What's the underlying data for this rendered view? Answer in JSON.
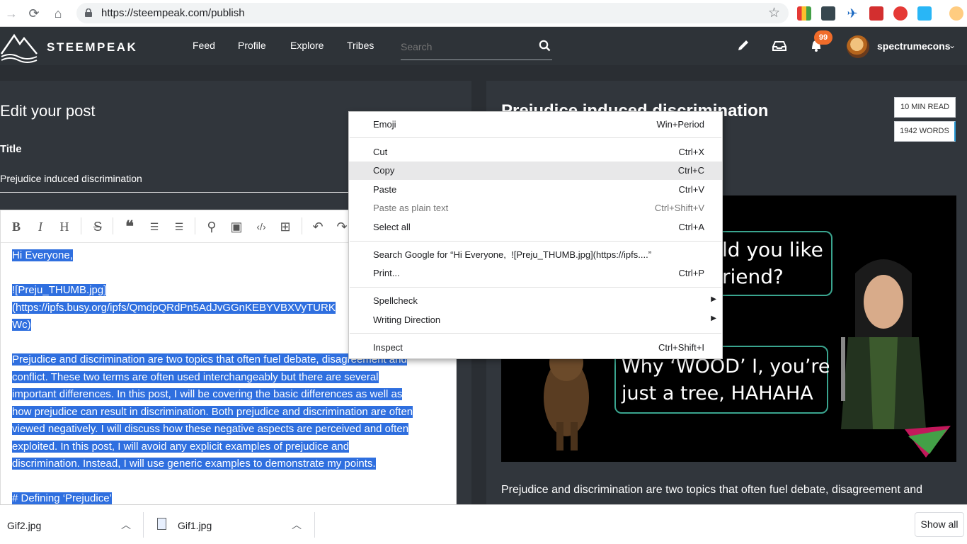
{
  "browser": {
    "url": "https://steempeak.com/publish"
  },
  "header": {
    "logo_text": "STEEMPEAK",
    "nav": [
      "Feed",
      "Profile",
      "Explore",
      "Tribes"
    ],
    "search_placeholder": "Search",
    "notification_count": "99",
    "username": "spectrumecons"
  },
  "editor": {
    "heading": "Edit your post",
    "title_label": "Title",
    "title_value": "Prejudice induced discrimination",
    "lines": {
      "l1": "Hi Everyone,",
      "l2": "![Preju_THUMB.jpg]",
      "l3": "(https://ipfs.busy.org/ipfs/QmdpQRdPn5AdJvGGnKEBYVBXVyTURK",
      "l4": "Wc)",
      "p1": "Prejudice and discrimination are two topics that often fuel debate, disagreement and",
      "p2": "conflict. These two terms are often used interchangeably but there are several",
      "p3": "important differences. In this post, I will be covering the basic differences as well as",
      "p4": "how prejudice can result in discrimination. Both prejudice and discrimination are often",
      "p5": "viewed negatively. I will discuss how these negative aspects are perceived and often",
      "p6": "exploited. In this post, I will avoid any explicit examples of prejudice and",
      "p7": "discrimination. Instead, I will use generic examples to demonstrate my points.",
      "h1": "# Defining ‘Prejudice’"
    }
  },
  "preview": {
    "title": "Prejudice induced discrimination",
    "read_time": "10 MIN READ",
    "word_count": "1942 WORDS",
    "image_text_1a": "ld you like",
    "image_text_1b": "riend?",
    "image_text_2a": "Why ‘WOOD’ I, you’re",
    "image_text_2b": "just a tree, HAHAHA",
    "body_line1": "Prejudice and discrimination are two topics that often fuel debate, disagreement and"
  },
  "context_menu": {
    "emoji": {
      "label": "Emoji",
      "shortcut": "Win+Period"
    },
    "cut": {
      "label": "Cut",
      "shortcut": "Ctrl+X"
    },
    "copy": {
      "label": "Copy",
      "shortcut": "Ctrl+C"
    },
    "paste": {
      "label": "Paste",
      "shortcut": "Ctrl+V"
    },
    "paste_plain": {
      "label": "Paste as plain text",
      "shortcut": "Ctrl+Shift+V"
    },
    "select_all": {
      "label": "Select all",
      "shortcut": "Ctrl+A"
    },
    "search_google": {
      "label": "Search Google for “Hi Everyone,  ![Preju_THUMB.jpg](https://ipfs....”"
    },
    "print": {
      "label": "Print...",
      "shortcut": "Ctrl+P"
    },
    "spellcheck": {
      "label": "Spellcheck"
    },
    "writing_direction": {
      "label": "Writing Direction"
    },
    "inspect": {
      "label": "Inspect",
      "shortcut": "Ctrl+Shift+I"
    }
  },
  "downloads": {
    "items": [
      {
        "name": "Gif2.jpg"
      },
      {
        "name": "Gif1.jpg"
      }
    ],
    "show_all": "Show all"
  }
}
